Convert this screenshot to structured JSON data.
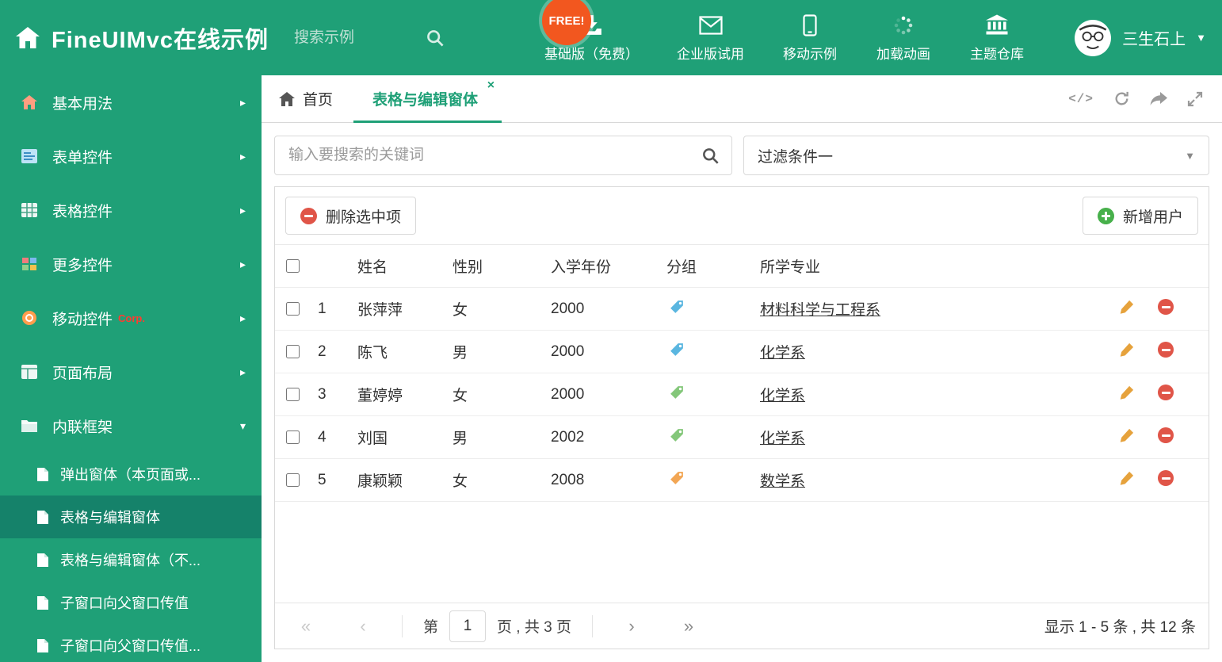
{
  "colors": {
    "accent": "#1fa077",
    "sidebar_active": "#15826a",
    "free_badge": "#f2571f",
    "corp_badge": "#ff3b30",
    "delete_red": "#e05548",
    "add_green": "#47b04b",
    "edit_orange": "#e6a23c"
  },
  "header": {
    "brand": "FineUIMvc在线示例",
    "search_placeholder": "搜索示例",
    "free_badge": "FREE!",
    "nav": [
      {
        "label": "基础版（免费）"
      },
      {
        "label": "企业版试用"
      },
      {
        "label": "移动示例"
      },
      {
        "label": "加载动画"
      },
      {
        "label": "主题仓库"
      }
    ],
    "user_name": "三生石上"
  },
  "sidebar": {
    "items": [
      {
        "label": "基本用法"
      },
      {
        "label": "表单控件"
      },
      {
        "label": "表格控件"
      },
      {
        "label": "更多控件"
      },
      {
        "label": "移动控件",
        "badge": "Corp."
      },
      {
        "label": "页面布局"
      },
      {
        "label": "内联框架"
      }
    ],
    "subitems": [
      {
        "label": "弹出窗体（本页面或..."
      },
      {
        "label": "表格与编辑窗体"
      },
      {
        "label": "表格与编辑窗体（不..."
      },
      {
        "label": "子窗口向父窗口传值"
      },
      {
        "label": "子窗口向父窗口传值..."
      }
    ]
  },
  "tabs": {
    "home": "首页",
    "active": "表格与编辑窗体"
  },
  "filter": {
    "search_placeholder": "输入要搜索的关键词",
    "dropdown_value": "过滤条件一"
  },
  "toolbar": {
    "delete_label": "删除选中项",
    "add_label": "新增用户"
  },
  "table": {
    "headers": {
      "name": "姓名",
      "gender": "性别",
      "year": "入学年份",
      "group": "分组",
      "major": "所学专业"
    },
    "rows": [
      {
        "num": "1",
        "name": "张萍萍",
        "gender": "女",
        "year": "2000",
        "tag_color": "#5ab6e0",
        "major": "材料科学与工程系"
      },
      {
        "num": "2",
        "name": "陈飞",
        "gender": "男",
        "year": "2000",
        "tag_color": "#5ab6e0",
        "major": "化学系"
      },
      {
        "num": "3",
        "name": "董婷婷",
        "gender": "女",
        "year": "2000",
        "tag_color": "#84c77a",
        "major": "化学系"
      },
      {
        "num": "4",
        "name": "刘国",
        "gender": "男",
        "year": "2002",
        "tag_color": "#84c77a",
        "major": "化学系"
      },
      {
        "num": "5",
        "name": "康颖颖",
        "gender": "女",
        "year": "2008",
        "tag_color": "#f2a654",
        "major": "数学系"
      }
    ]
  },
  "pagination": {
    "page_prefix": "第",
    "current_page": "1",
    "page_suffix": "页 , 共 3 页",
    "summary": "显示 1 - 5 条 , 共 12 条"
  }
}
